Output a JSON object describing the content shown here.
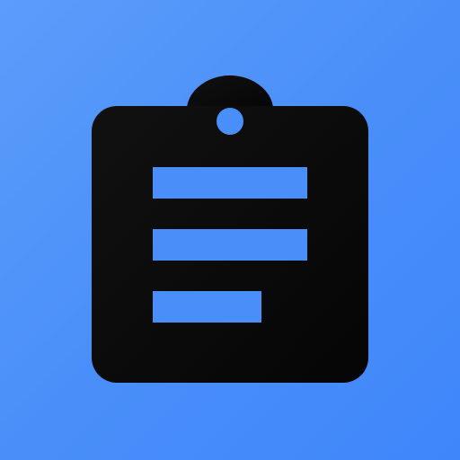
{
  "icon": {
    "name": "clipboard-list-icon",
    "background_gradient": [
      "#5b9dfb",
      "#3f86fb"
    ],
    "body_color": "#0a0a0a",
    "line_color": "#4a8ff9",
    "hole_color": "#4a8ff9"
  }
}
